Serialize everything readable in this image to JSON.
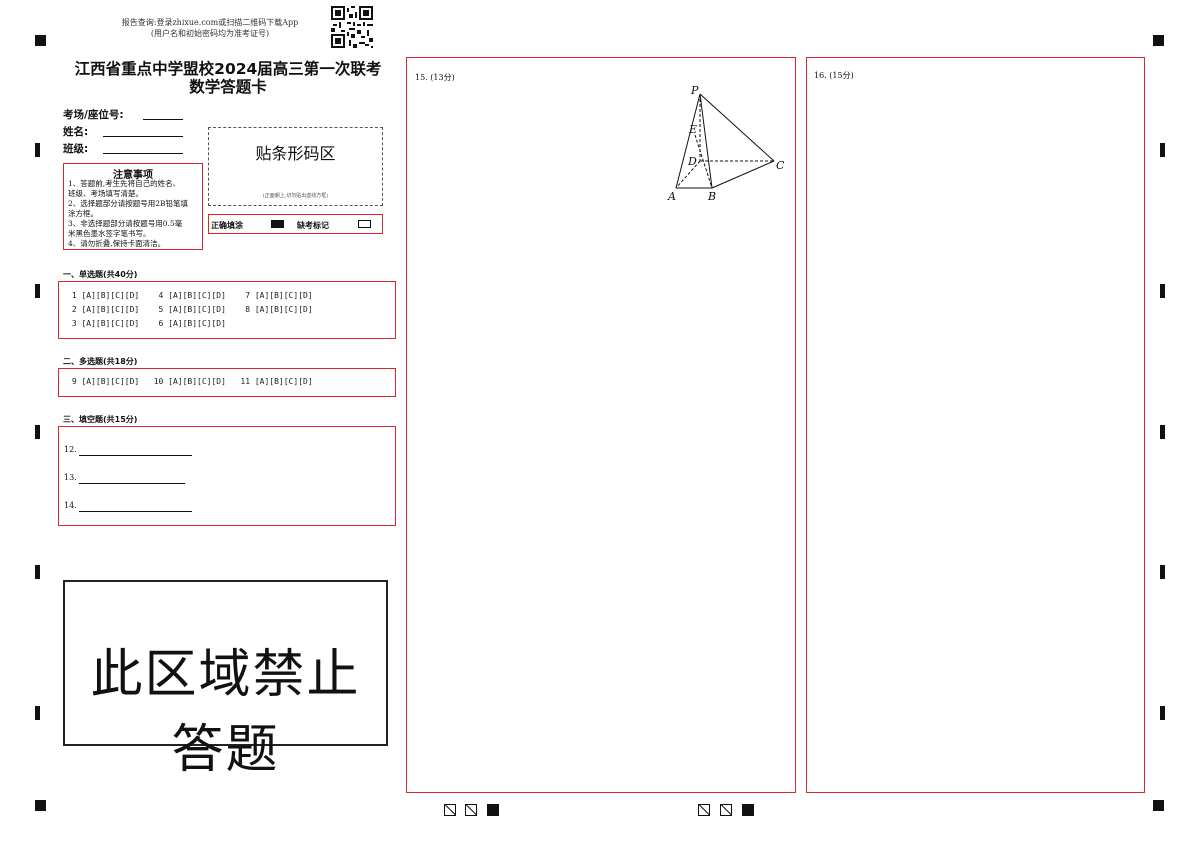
{
  "header": {
    "query_line1": "报告查询:登录zhixue.com或扫描二维码下载App",
    "query_line2": "(用户名和初始密码均为准考证号)",
    "title_line1": "江西省重点中学盟校2024届高三第一次联考",
    "title_line2": "数学答题卡"
  },
  "info": {
    "room_seat": "考场/座位号:",
    "name": "姓名:",
    "class": "班级:"
  },
  "barcode": {
    "label": "贴条形码区",
    "hint": "(正面朝上,切勿贴出虚线方框)"
  },
  "notice": {
    "title": "注意事项",
    "lines": [
      "1、答题前,考生先将自己的姓名、",
      "班级、考场填写清楚。",
      "2、选择题部分请按题号用2B铅笔填",
      "涂方框。",
      "3、非选择题部分请按题号用0.5毫",
      "米黑色墨水签字笔书写。",
      "4、请勿折叠,保持卡面清洁。"
    ]
  },
  "legend": {
    "correct": "正确填涂",
    "absent": "缺考标记"
  },
  "sections": {
    "single": {
      "title": "一、单选题(共40分)",
      "rows": [
        " 1 [A][B][C][D]    4 [A][B][C][D]    7 [A][B][C][D]",
        " 2 [A][B][C][D]    5 [A][B][C][D]    8 [A][B][C][D]",
        " 3 [A][B][C][D]    6 [A][B][C][D]"
      ]
    },
    "multi": {
      "title": "二、多选题(共18分)",
      "rows": [
        " 9 [A][B][C][D]   10 [A][B][C][D]   11 [A][B][C][D]"
      ]
    },
    "fill": {
      "title": "三、填空题(共15分)",
      "items": [
        "12.",
        "13.",
        "14."
      ]
    }
  },
  "forbidden": "此区域禁止答题",
  "questions": {
    "q15": "15. (13分)",
    "q16": "16. (15分)"
  },
  "figure": {
    "labels": [
      "P",
      "E",
      "D",
      "C",
      "A",
      "B"
    ]
  }
}
